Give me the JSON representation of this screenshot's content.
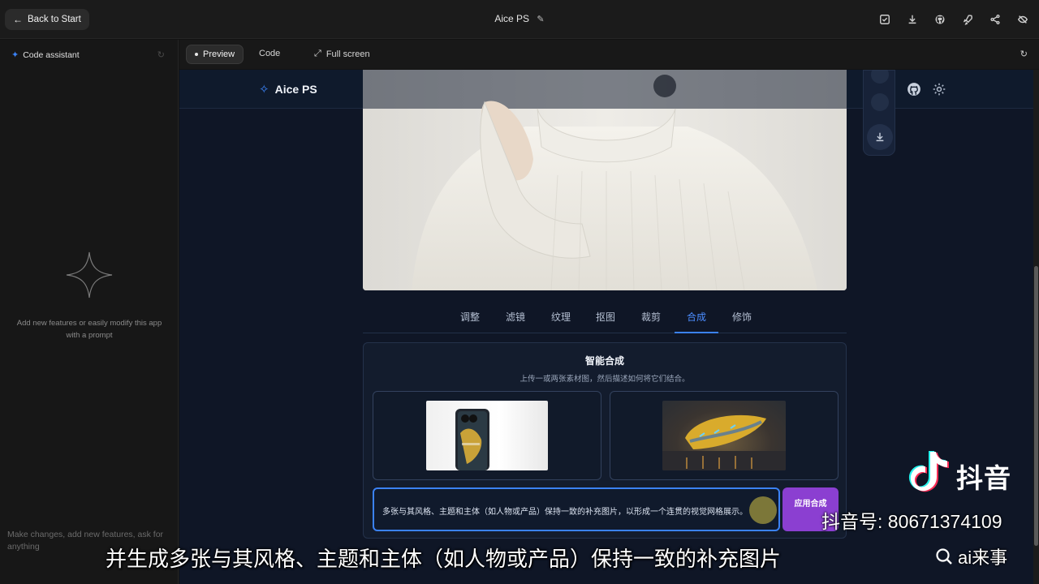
{
  "topbar": {
    "back_label": "Back to Start",
    "title": "Aice PS"
  },
  "left_panel": {
    "header": "Code assistant",
    "hint": "Add new features or easily modify this app with a prompt",
    "input_placeholder": "Make changes, add new features, ask for anything"
  },
  "preview_toolbar": {
    "preview_label": "Preview",
    "code_label": "Code",
    "fullscreen_label": "Full screen"
  },
  "app": {
    "logo_text": "Aice PS",
    "tabs": [
      {
        "label": "调整"
      },
      {
        "label": "滤镜"
      },
      {
        "label": "纹理"
      },
      {
        "label": "抠图"
      },
      {
        "label": "裁剪"
      },
      {
        "label": "合成"
      },
      {
        "label": "修饰"
      }
    ],
    "active_tab": "合成",
    "compose": {
      "title": "智能合成",
      "subtitle": "上传一或两张素材图，然后描述如何将它们结合。",
      "prompt_value": "多张与其风格、主题和主体（如人物或产品）保持一致的补充图片，以形成一个连贯的视觉网格展示。",
      "apply_label": "应用合成"
    }
  },
  "overlay": {
    "brand": "抖音",
    "account": "抖音号: 80671374109",
    "subtitle": "并生成多张与其风格、主题和主体（如人物或产品）保持一致的补充图片",
    "search_tag": "ai来事"
  },
  "colors": {
    "accent": "#3b82f6",
    "apply_button": "#8b3fd1",
    "app_background": "#0f1626"
  }
}
